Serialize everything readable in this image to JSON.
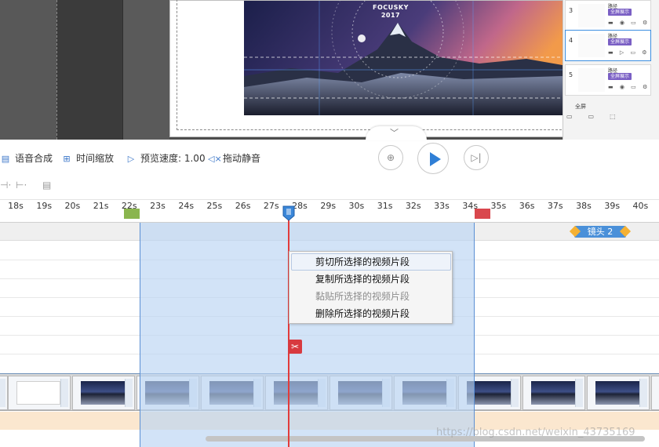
{
  "slide": {
    "brand_line1": "FOCUSKY",
    "brand_line2": "2017"
  },
  "scenes": [
    {
      "number": "3",
      "title": "路径",
      "tag": "全屏展示"
    },
    {
      "number": "4",
      "title": "路径",
      "tag": "全屏展示"
    },
    {
      "number": "5",
      "title": "路径",
      "tag": "全屏展示"
    }
  ],
  "scene_panel": {
    "add_label": "全屏"
  },
  "toolbar": {
    "tts_label": "语音合成",
    "time_scale_label": "时间缩放",
    "preview_speed_label": "预览速度: 1.00",
    "drag_mute_label": "拖动静音"
  },
  "ruler": {
    "ticks": [
      "18s",
      "19s",
      "20s",
      "21s",
      "22s",
      "23s",
      "24s",
      "25s",
      "26s",
      "27s",
      "28s",
      "29s",
      "30s",
      "31s",
      "32s",
      "33s",
      "34s",
      "35s",
      "36s",
      "37s",
      "38s",
      "39s",
      "40s"
    ]
  },
  "shot_tag": {
    "label": "镜头 2"
  },
  "context_menu": {
    "items": [
      {
        "label": "剪切所选择的视频片段",
        "state": "hover"
      },
      {
        "label": "复制所选择的视频片段",
        "state": "normal"
      },
      {
        "label": "黏贴所选择的视频片段",
        "state": "disabled"
      },
      {
        "label": "删除所选择的视频片段",
        "state": "normal"
      }
    ]
  },
  "watermark": "https://blog.csdn.net/weixin_43735169",
  "colors": {
    "selection": "#bad4f2",
    "playhead": "#e23b3b",
    "accent_blue": "#2f7fd6",
    "scene_tag": "#7a5fc4"
  },
  "icons": {
    "tts": "tts-icon",
    "time_scale": "time-scale-icon",
    "preview_speed": "preview-speed-icon",
    "drag_mute": "speaker-mute-icon",
    "zoom_fit": "zoom-fit-icon",
    "play": "play-icon",
    "next_frame": "next-frame-icon",
    "scissors": "scissors-icon"
  }
}
